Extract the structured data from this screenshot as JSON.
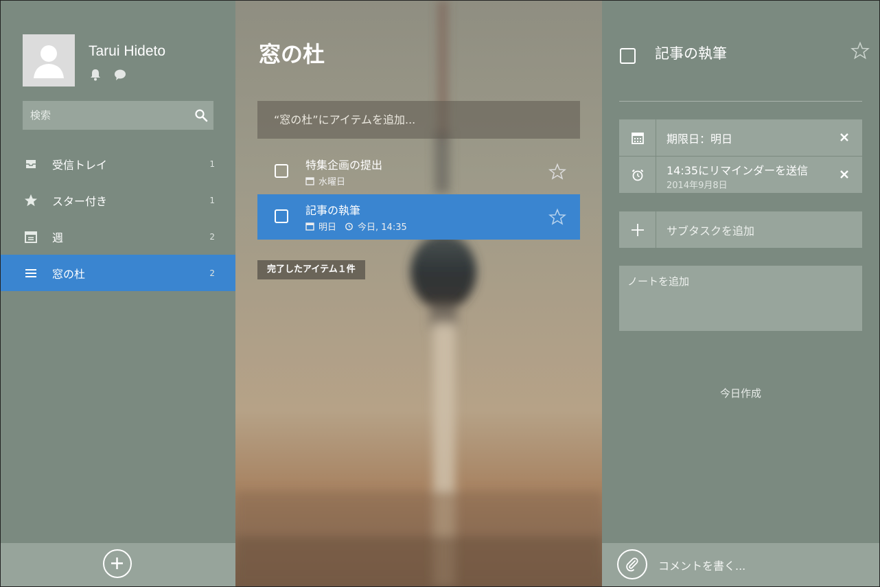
{
  "user": {
    "name": "Tarui Hideto"
  },
  "search": {
    "placeholder": "検索"
  },
  "sidebar": {
    "items": [
      {
        "label": "受信トレイ",
        "count": "1",
        "icon": "inbox-icon"
      },
      {
        "label": "スター付き",
        "count": "1",
        "icon": "star-icon"
      },
      {
        "label": "週",
        "count": "2",
        "icon": "calendar-icon"
      },
      {
        "label": "窓の杜",
        "count": "2",
        "icon": "list-icon",
        "active": true
      }
    ]
  },
  "list": {
    "title": "窓の杜",
    "add_placeholder": "“窓の杜”にアイテムを追加...",
    "tasks": [
      {
        "title": "特集企画の提出",
        "due": "水曜日",
        "starred": false
      },
      {
        "title": "記事の執筆",
        "due": "明日",
        "reminder": "今日, 14:35",
        "selected": true,
        "starred": false
      }
    ],
    "completed_label": "完了したアイテム１件"
  },
  "detail": {
    "title": "記事の執筆",
    "due_label": "期限日：明日",
    "reminder_label": "14:35にリマインダーを送信",
    "reminder_date": "2014年9月8日",
    "subtask_placeholder": "サブタスクを追加",
    "note_placeholder": "ノートを追加",
    "created": "今日作成",
    "comment_placeholder": "コメントを書く..."
  },
  "colors": {
    "accent": "#3a85d0",
    "panel": "#7b8a80",
    "field": "#98a59c"
  }
}
